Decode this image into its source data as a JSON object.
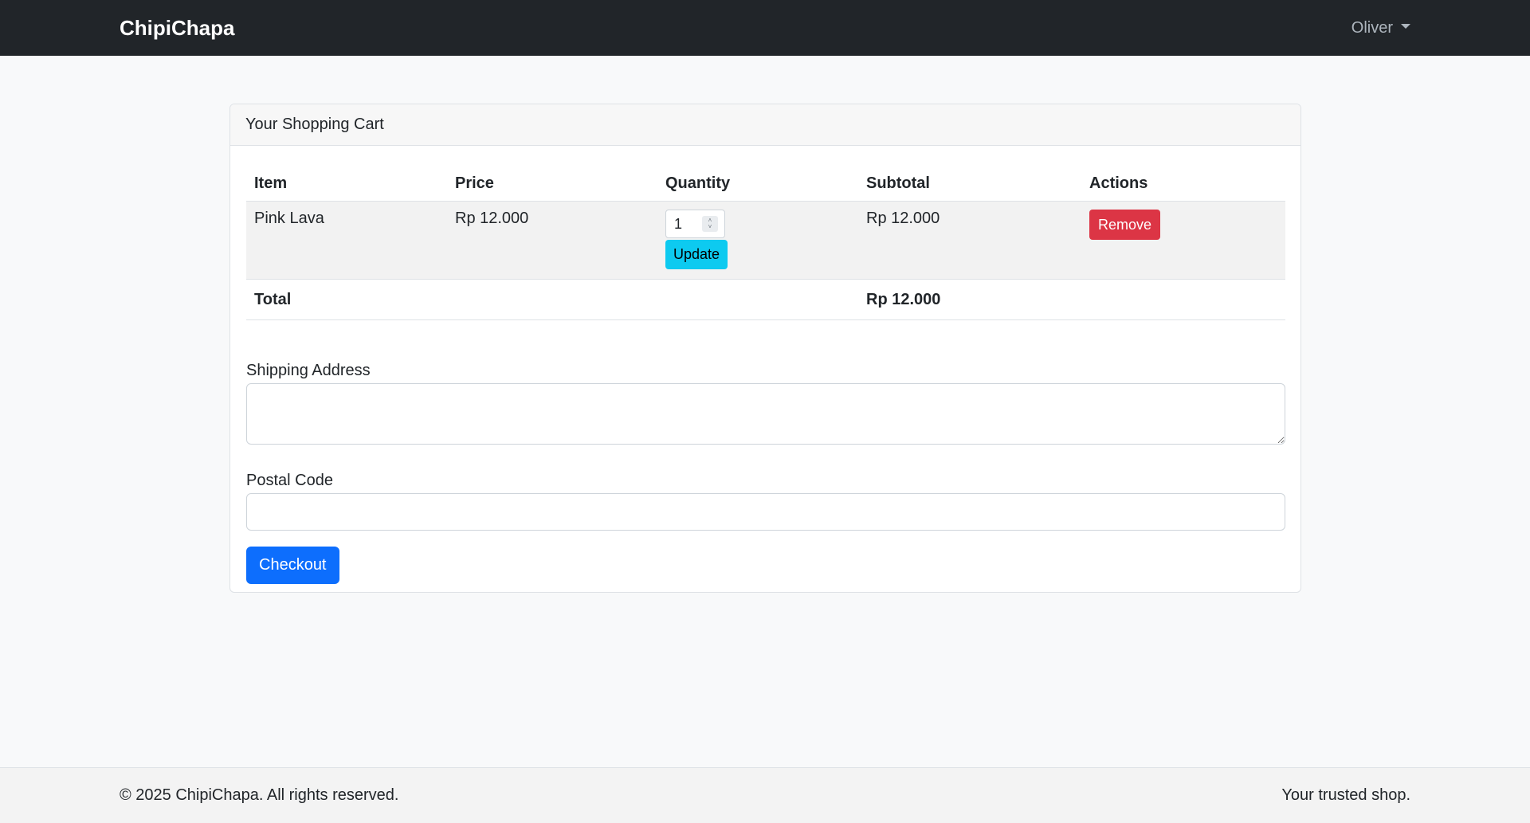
{
  "navbar": {
    "brand": "ChipiChapa",
    "user": "Oliver"
  },
  "cart": {
    "title": "Your Shopping Cart",
    "columns": [
      "Item",
      "Price",
      "Quantity",
      "Subtotal",
      "Actions"
    ],
    "items": [
      {
        "name": "Pink Lava",
        "price": "Rp 12.000",
        "quantity": "1",
        "subtotal": "Rp 12.000",
        "update_label": "Update",
        "remove_label": "Remove"
      }
    ],
    "total_label": "Total",
    "total_value": "Rp 12.000"
  },
  "form": {
    "address_label": "Shipping Address",
    "address_value": "",
    "postal_label": "Postal Code",
    "postal_value": "",
    "checkout_label": "Checkout"
  },
  "footer": {
    "copyright": "© 2025 ChipiChapa. All rights reserved.",
    "tagline": "Your trusted shop."
  },
  "colors": {
    "navbar_bg": "#212529",
    "update_button": "#0dcaf0",
    "remove_button": "#dc3545",
    "checkout_button": "#0d6efd"
  }
}
